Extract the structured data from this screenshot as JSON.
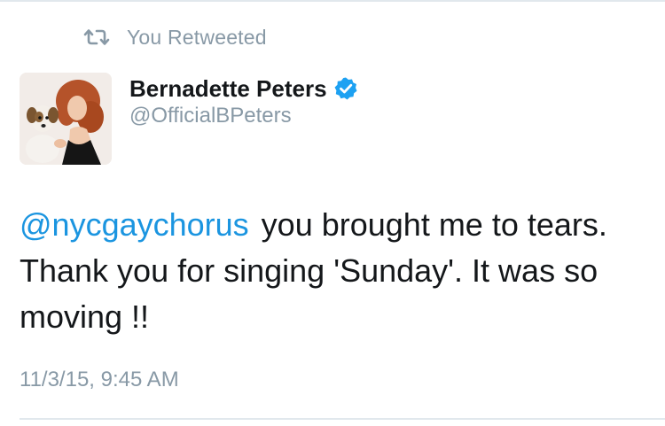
{
  "social_context": {
    "label": "You Retweeted",
    "icon": "retweet-icon"
  },
  "author": {
    "display_name": "Bernadette Peters",
    "handle": "@OfficialBPeters",
    "verified_icon": "verified-badge-icon",
    "avatar_icon": "avatar"
  },
  "tweet": {
    "mention": "@nycgaychorus",
    "text_body": "you brought me to tears. Thank you for singing 'Sunday'. It was so moving !!",
    "timestamp": "11/3/15, 9:45 AM"
  },
  "colors": {
    "link": "#1b95e0",
    "secondary_text": "#8899a6",
    "primary_text": "#14171a",
    "verified": "#1da1f2",
    "divider": "#e1e8ed"
  }
}
